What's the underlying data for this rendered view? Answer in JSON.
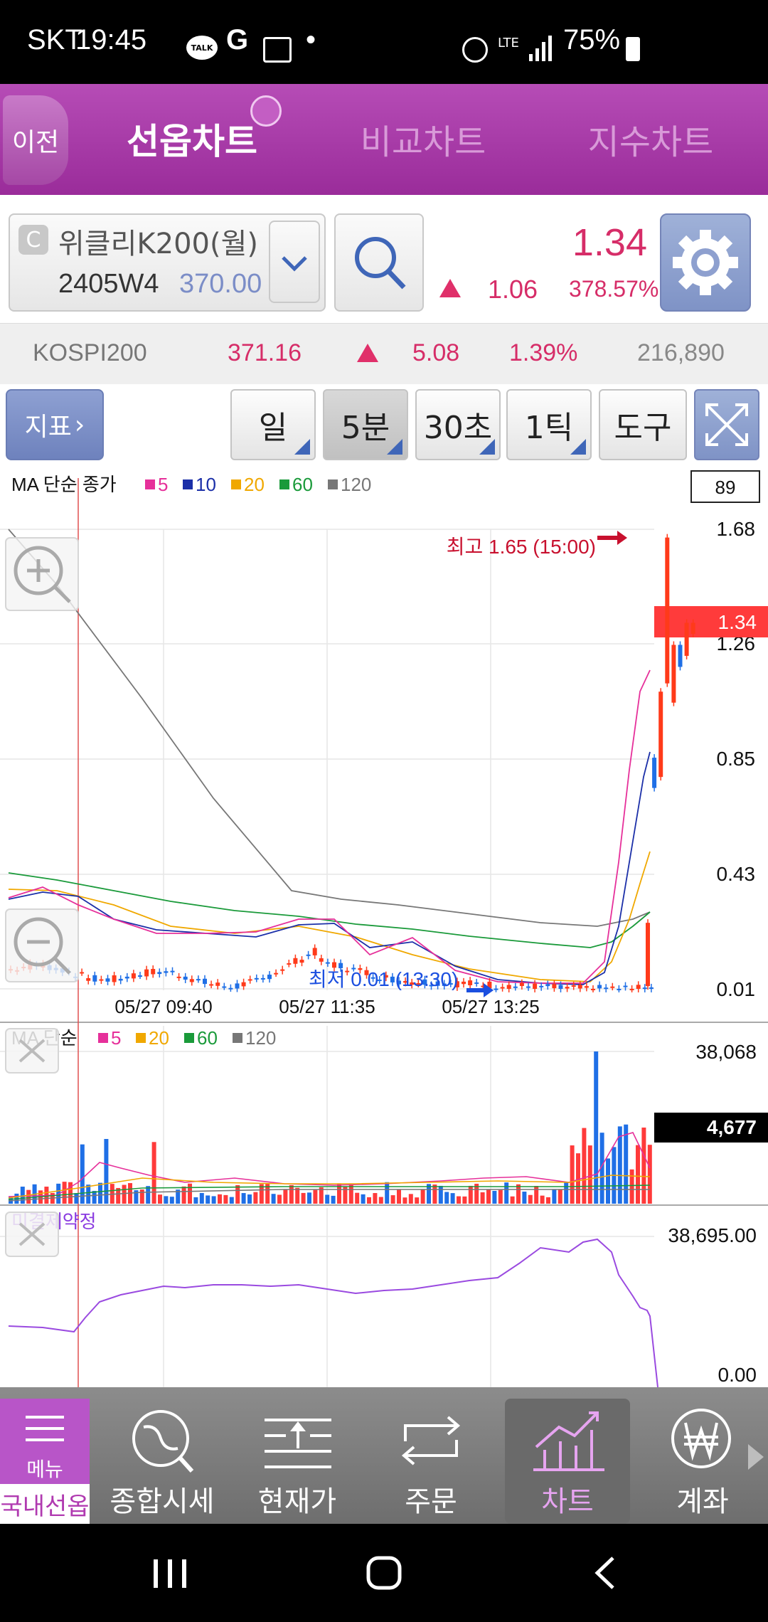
{
  "status_bar": {
    "carrier": "SKT",
    "time": "19:45",
    "talk": "TALK",
    "g": "G",
    "dot": "•",
    "lte": "LTE",
    "battery": "75%"
  },
  "header": {
    "back": "이전",
    "tabs": [
      {
        "label": "선옵차트"
      },
      {
        "label": "비교차트"
      },
      {
        "label": "지수차트"
      }
    ]
  },
  "instrument": {
    "badge": "C",
    "name": "위클리K200(월)",
    "code": "2405W4",
    "strike": "370.00",
    "price": "1.34",
    "change": "1.06",
    "change_pct": "378.57%"
  },
  "index": {
    "name": "KOSPI200",
    "price": "371.16",
    "change": "5.08",
    "change_pct": "1.39%",
    "volume": "216,890"
  },
  "toolbar": {
    "indicator": "지표",
    "day": "일",
    "min5": "5분",
    "sec30": "30초",
    "tick": "1틱",
    "tools": "도구"
  },
  "main_chart": {
    "legend_title": "MA 단순 종가",
    "ma_legend": [
      {
        "label": "5",
        "color": "#e6309a"
      },
      {
        "label": "10",
        "color": "#1b2fa8"
      },
      {
        "label": "20",
        "color": "#f0a800"
      },
      {
        "label": "60",
        "color": "#1a9a3a"
      },
      {
        "label": "120",
        "color": "#777777"
      }
    ],
    "count_box": "89",
    "y_ticks": [
      "1.68",
      "1.26",
      "0.85",
      "0.43",
      "0.01"
    ],
    "current_price": "1.34",
    "high_note": "최고 1.65 (15:00)",
    "low_note": "최저 0.01 (13:30)",
    "x_ticks": [
      "05/27 09:40",
      "05/27 11:35",
      "05/27 13:25"
    ]
  },
  "volume_chart": {
    "legend_title": "MA 단순",
    "ma_legend": [
      {
        "label": "5",
        "color": "#e6309a"
      },
      {
        "label": "20",
        "color": "#f0a800"
      },
      {
        "label": "60",
        "color": "#1a9a3a"
      },
      {
        "label": "120",
        "color": "#777777"
      }
    ],
    "max": "38,068",
    "current": "4,677"
  },
  "oi_chart": {
    "title": "미결제약정",
    "max": "38,695.00",
    "min": "0.00"
  },
  "bottom_nav": {
    "items": [
      {
        "label": "국내선옵",
        "sub": "메뉴"
      },
      {
        "label": "종합시세"
      },
      {
        "label": "현재가"
      },
      {
        "label": "주문"
      },
      {
        "label": "차트"
      },
      {
        "label": "계좌"
      }
    ]
  },
  "chart_data": [
    {
      "type": "candlestick",
      "title": "MA 단순 종가",
      "ylim": [
        0.01,
        1.68
      ],
      "x_ticks": [
        "05/27 09:40",
        "05/27 11:35",
        "05/27 13:25"
      ],
      "high": 1.65,
      "low": 0.01,
      "last": 1.34,
      "series": [
        {
          "name": "5"
        },
        {
          "name": "10"
        },
        {
          "name": "20"
        },
        {
          "name": "60"
        },
        {
          "name": "120"
        }
      ]
    },
    {
      "type": "bar",
      "title": "MA 단순",
      "ylim": [
        0,
        38068
      ],
      "last": 4677
    },
    {
      "type": "line",
      "title": "미결제약정",
      "ylim": [
        0.0,
        38695.0
      ]
    }
  ]
}
